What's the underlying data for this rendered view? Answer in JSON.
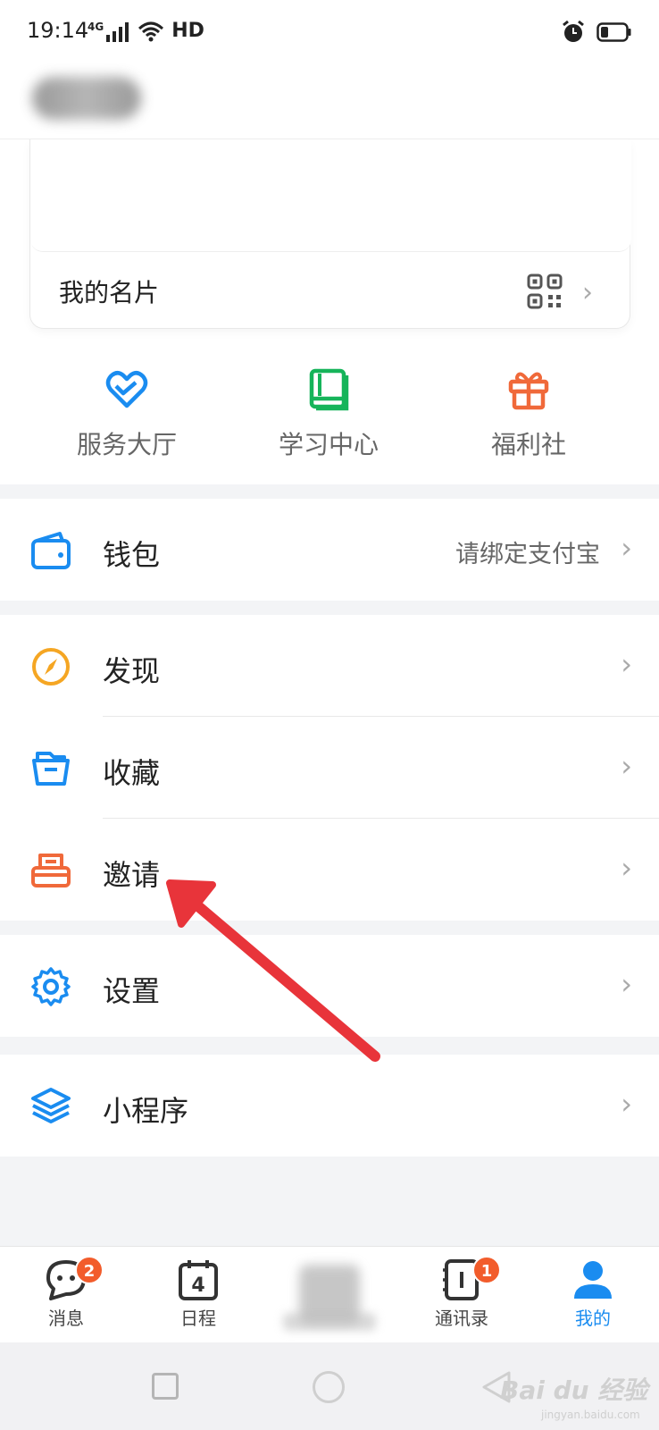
{
  "status_bar": {
    "time": "19:14",
    "network": "4G",
    "hd": "HD"
  },
  "card": {
    "label": "我的名片"
  },
  "quick_actions": [
    {
      "label": "服务大厅",
      "icon": "heart-icon",
      "color": "#1a8cf0"
    },
    {
      "label": "学习中心",
      "icon": "book-icon",
      "color": "#16b45a"
    },
    {
      "label": "福利社",
      "icon": "gift-icon",
      "color": "#f0693a"
    }
  ],
  "menu": {
    "wallet": {
      "label": "钱包",
      "value": "请绑定支付宝",
      "icon": "wallet-icon"
    },
    "discover": {
      "label": "发现",
      "icon": "compass-icon"
    },
    "favorites": {
      "label": "收藏",
      "icon": "folder-icon"
    },
    "invite": {
      "label": "邀请",
      "icon": "invite-icon"
    },
    "settings": {
      "label": "设置",
      "icon": "gear-icon"
    },
    "mini_programs": {
      "label": "小程序",
      "icon": "layers-icon"
    }
  },
  "tabbar": {
    "messages": {
      "label": "消息",
      "badge": "2"
    },
    "calendar": {
      "label": "日程",
      "day": "4"
    },
    "contacts": {
      "label": "通讯录",
      "badge": "1"
    },
    "mine": {
      "label": "我的"
    }
  },
  "watermark": {
    "text": "Bai du 经验",
    "sub": "jingyan.baidu.com"
  },
  "colors": {
    "accent": "#1a8cf0",
    "badge": "#f25c2b",
    "annotation_arrow": "#e8343a"
  }
}
